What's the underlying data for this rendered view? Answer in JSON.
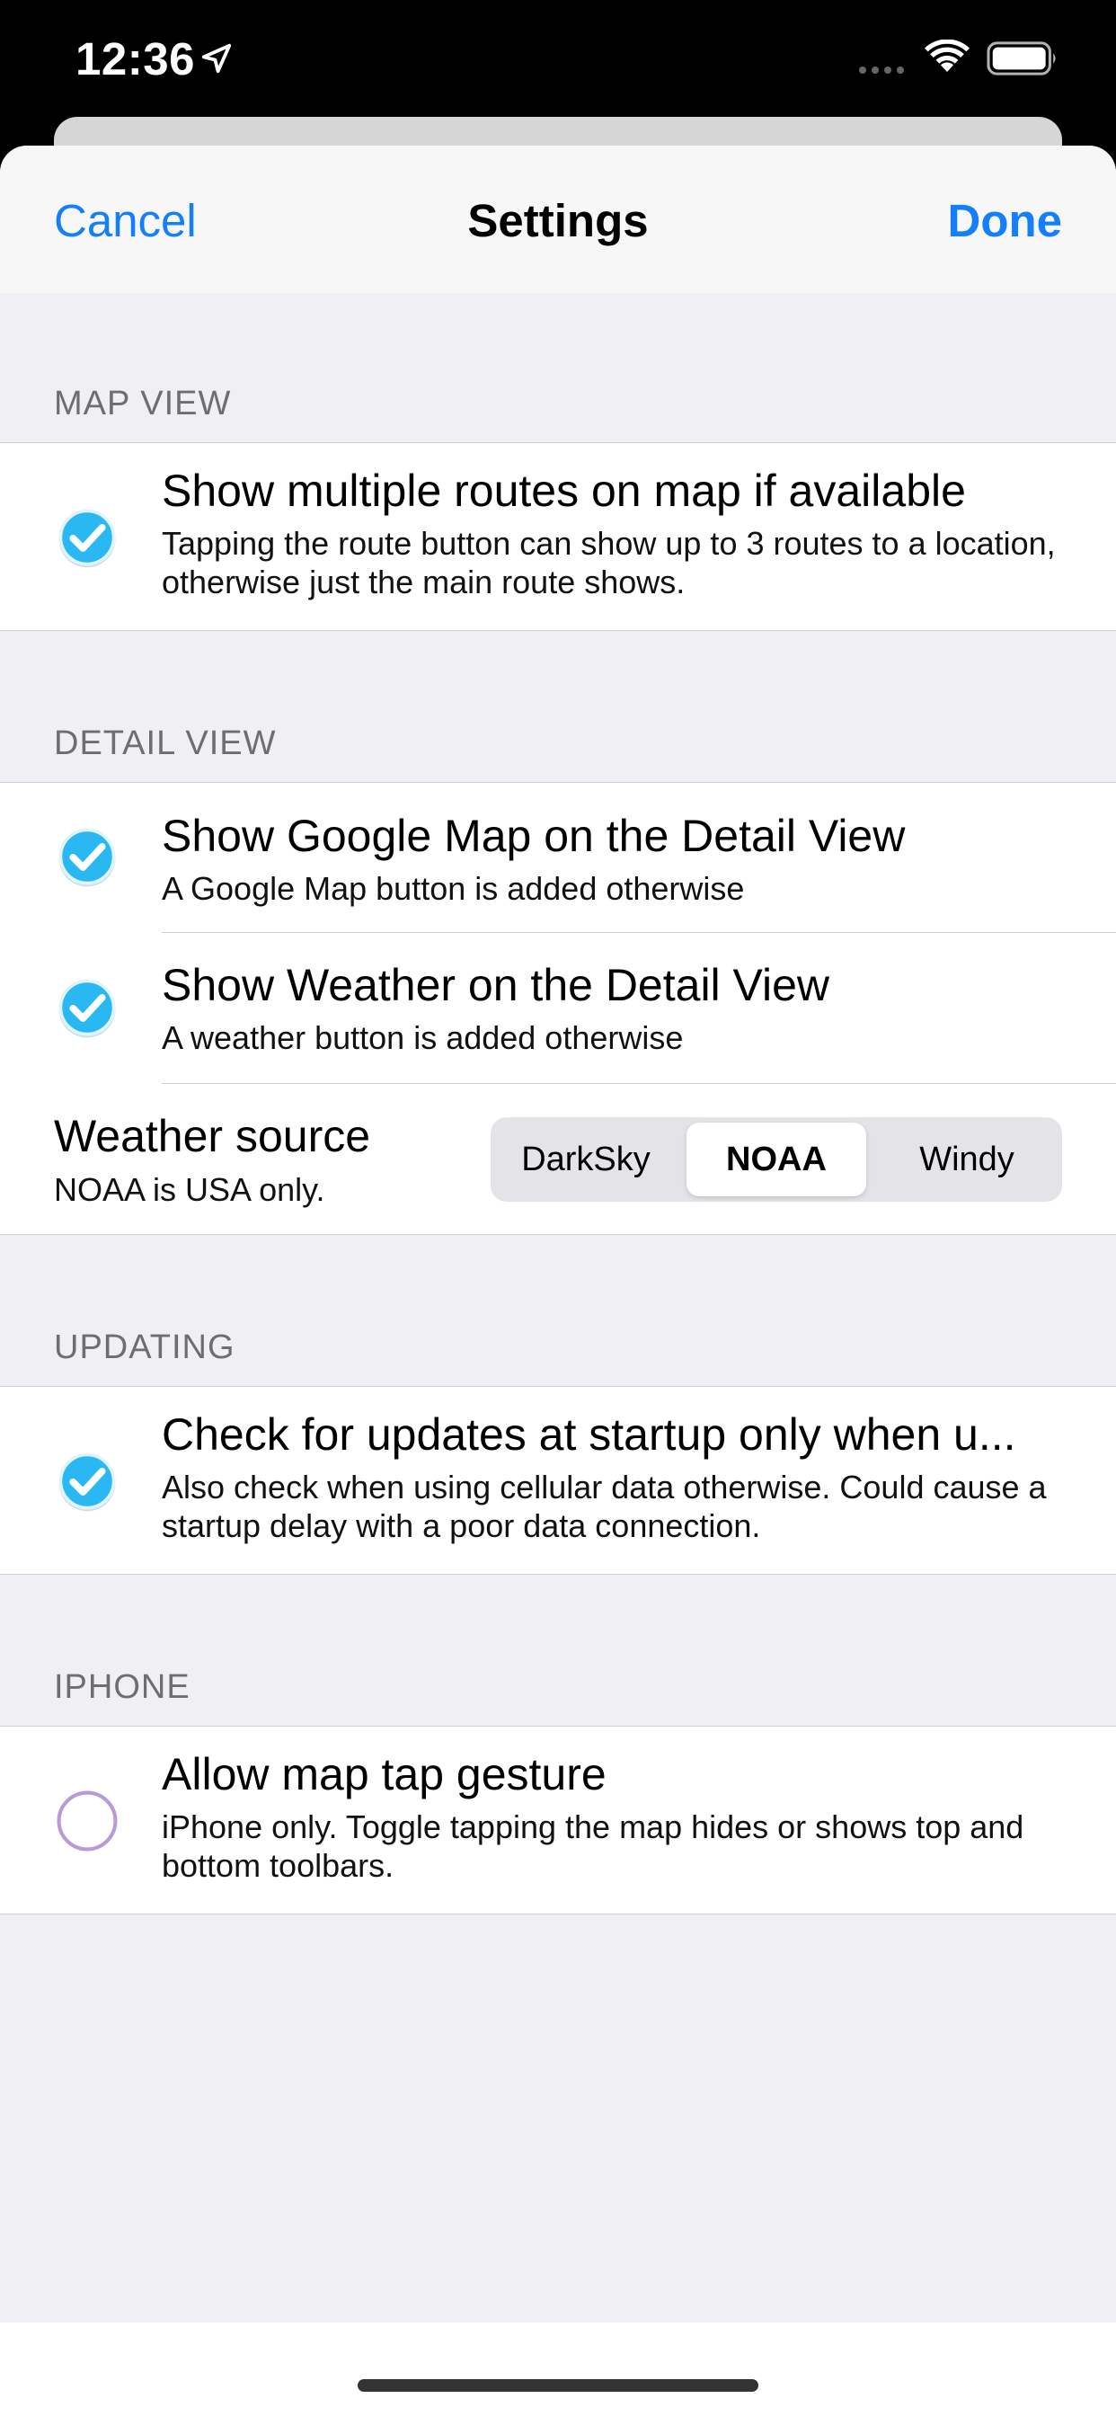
{
  "status_bar": {
    "time": "12:36",
    "icons": [
      "location-arrow-icon",
      "signal-dots-icon",
      "wifi-icon",
      "battery-icon"
    ]
  },
  "nav": {
    "cancel_label": "Cancel",
    "title": "Settings",
    "done_label": "Done"
  },
  "colors": {
    "accent": "#147efb",
    "check_fill": "#29b8f2",
    "unchecked_ring": "#b89ad8",
    "background": "#efeff4"
  },
  "sections": {
    "map_view": {
      "header": "MAP VIEW",
      "multiple_routes": {
        "checked": true,
        "title": "Show multiple routes on map if available",
        "subtitle": "Tapping the route button can show up to 3 routes to a location, otherwise just the main route shows."
      }
    },
    "detail_view": {
      "header": "DETAIL VIEW",
      "google_map": {
        "checked": true,
        "title": "Show Google Map on the Detail View",
        "subtitle": "A Google Map button is added otherwise"
      },
      "weather": {
        "checked": true,
        "title": "Show Weather on the Detail View",
        "subtitle": "A weather button is added otherwise"
      },
      "weather_source": {
        "title": "Weather source",
        "subtitle": "NOAA is USA only.",
        "options": [
          "DarkSky",
          "NOAA",
          "Windy"
        ],
        "selected": "NOAA"
      }
    },
    "updating": {
      "header": "UPDATING",
      "check_updates": {
        "checked": true,
        "title": "Check for updates at startup only when u...",
        "subtitle": "Also check when using cellular data otherwise. Could cause a startup delay with a poor data connection."
      }
    },
    "iphone": {
      "header": "IPHONE",
      "map_tap": {
        "checked": false,
        "title": "Allow map tap gesture",
        "subtitle": "iPhone only.  Toggle tapping the map hides or shows top and bottom toolbars."
      }
    }
  }
}
